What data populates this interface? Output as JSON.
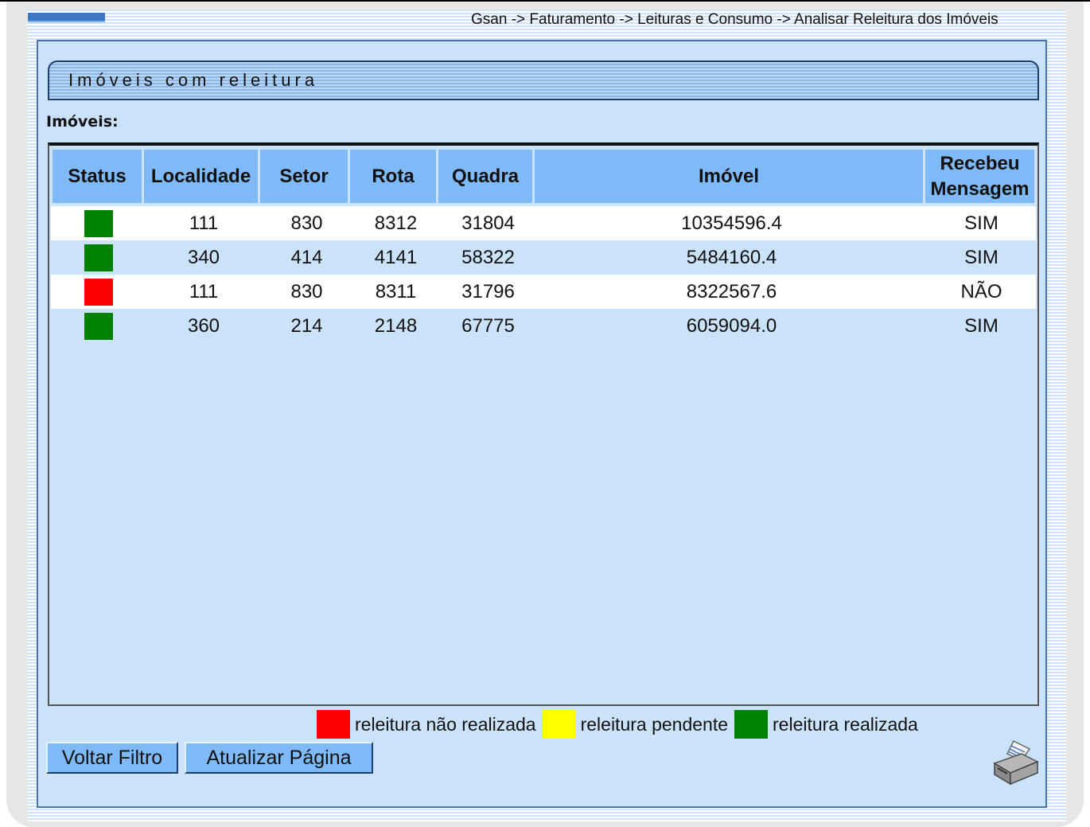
{
  "breadcrumb": "Gsan -> Faturamento -> Leituras e Consumo -> Analisar Releitura dos Imóveis",
  "panel_title": "Imóveis com releitura",
  "section_label": "Imóveis:",
  "table": {
    "headers": [
      "Status",
      "Localidade",
      "Setor",
      "Rota",
      "Quadra",
      "Imóvel",
      "Recebeu Mensagem"
    ],
    "rows": [
      {
        "status": "releitura realizada",
        "status_color": "#008000",
        "localidade": "111",
        "setor": "830",
        "rota": "8312",
        "quadra": "31804",
        "imovel": "10354596.4",
        "recebeu": "SIM"
      },
      {
        "status": "releitura realizada",
        "status_color": "#008000",
        "localidade": "340",
        "setor": "414",
        "rota": "4141",
        "quadra": "58322",
        "imovel": "5484160.4",
        "recebeu": "SIM"
      },
      {
        "status": "releitura não realizada",
        "status_color": "#ff0000",
        "localidade": "111",
        "setor": "830",
        "rota": "8311",
        "quadra": "31796",
        "imovel": "8322567.6",
        "recebeu": "NÃO"
      },
      {
        "status": "releitura realizada",
        "status_color": "#008000",
        "localidade": "360",
        "setor": "214",
        "rota": "2148",
        "quadra": "67775",
        "imovel": "6059094.0",
        "recebeu": "SIM"
      }
    ]
  },
  "legend": [
    {
      "label": "releitura não realizada",
      "color": "#ff0000"
    },
    {
      "label": "releitura pendente",
      "color": "#ffff00"
    },
    {
      "label": "releitura realizada",
      "color": "#008000"
    }
  ],
  "buttons": {
    "voltar": "Voltar Filtro",
    "atualizar": "Atualizar Página"
  },
  "icons": {
    "print": "printer-icon"
  }
}
